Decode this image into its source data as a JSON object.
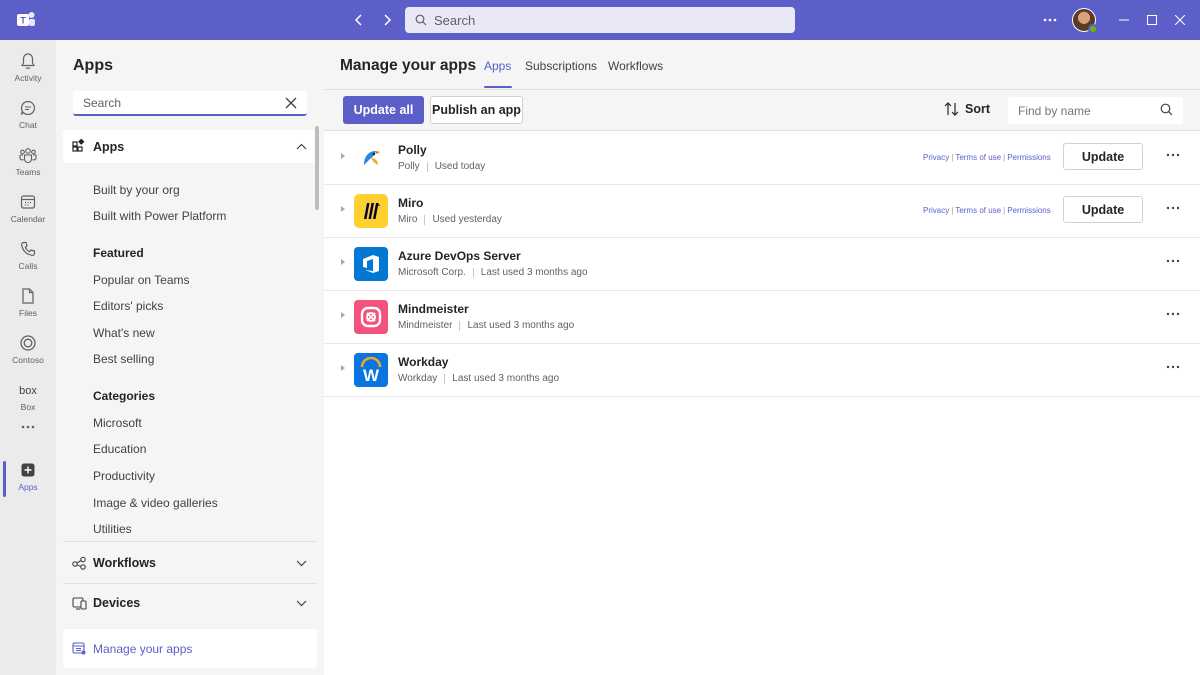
{
  "titlebar": {
    "search_placeholder": "Search",
    "colors": {
      "brand": "#5b5fc7"
    }
  },
  "rail": {
    "items": [
      {
        "label": "Activity",
        "icon": "bell-icon"
      },
      {
        "label": "Chat",
        "icon": "chat-icon"
      },
      {
        "label": "Teams",
        "icon": "teams-icon"
      },
      {
        "label": "Calendar",
        "icon": "calendar-icon"
      },
      {
        "label": "Calls",
        "icon": "phone-icon"
      },
      {
        "label": "Files",
        "icon": "file-icon"
      },
      {
        "label": "Contoso",
        "icon": "contoso-icon"
      },
      {
        "label": "Box",
        "icon": "box-icon"
      },
      {
        "label": "Apps",
        "icon": "apps-add-icon"
      }
    ],
    "active": "Apps"
  },
  "left": {
    "title": "Apps",
    "search_value": "Search",
    "apps_section": "Apps",
    "built_by_org": "Built by your org",
    "built_with_pp": "Built with Power Platform",
    "featured_heading": "Featured",
    "featured": [
      "Popular on Teams",
      "Editors' picks",
      "What's new",
      "Best selling"
    ],
    "categories_heading": "Categories",
    "categories": [
      "Microsoft",
      "Education",
      "Productivity",
      "Image & video galleries",
      "Utilities"
    ],
    "workflows": "Workflows",
    "devices": "Devices",
    "manage": "Manage your apps"
  },
  "main": {
    "title": "Manage your apps",
    "tabs": [
      "Apps",
      "Subscriptions",
      "Workflows"
    ],
    "active_tab": "Apps",
    "update_all": "Update all",
    "publish": "Publish an app",
    "sort": "Sort",
    "find_placeholder": "Find by name",
    "privacy": "Privacy",
    "terms": "Terms of use",
    "permissions": "Permissions",
    "update": "Update",
    "apps": [
      {
        "name": "Polly",
        "publisher": "Polly",
        "usage": "Used today",
        "has_update": true
      },
      {
        "name": "Miro",
        "publisher": "Miro",
        "usage": "Used yesterday",
        "has_update": true
      },
      {
        "name": "Azure DevOps Server",
        "publisher": "Microsoft Corp.",
        "usage": "Last used 3 months ago",
        "has_update": false
      },
      {
        "name": "Mindmeister",
        "publisher": "Mindmeister",
        "usage": "Last used 3 months ago",
        "has_update": false
      },
      {
        "name": "Workday",
        "publisher": "Workday",
        "usage": "Last used 3 months ago",
        "has_update": false
      }
    ]
  }
}
